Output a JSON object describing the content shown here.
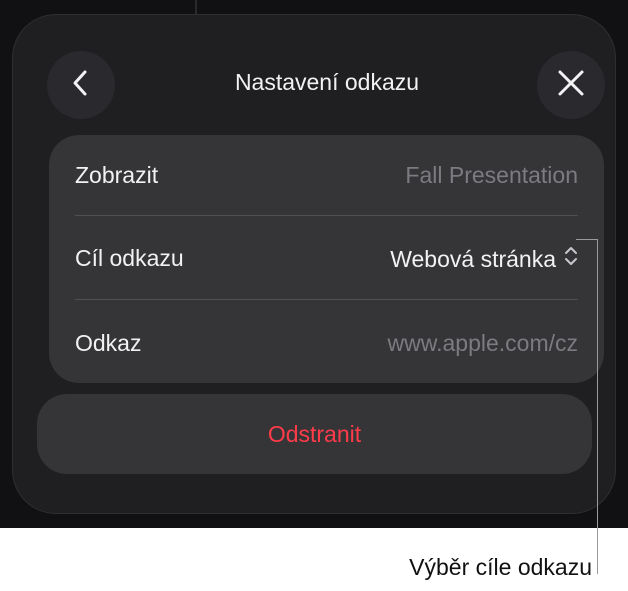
{
  "header": {
    "title": "Nastavení odkazu",
    "back_icon": "chevron-left-icon",
    "close_icon": "close-icon"
  },
  "settings": {
    "rows": [
      {
        "label": "Zobrazit",
        "value": "Fall Presentation"
      },
      {
        "label": "Cíl odkazu",
        "value": "Webová stránka",
        "icon": "chevron-up-down-icon"
      },
      {
        "label": "Odkaz",
        "value": "www.apple.com/cz"
      }
    ]
  },
  "actions": {
    "delete_label": "Odstranit"
  },
  "callout": {
    "text": "Výběr cíle odkazu"
  },
  "colors": {
    "background": "#111113",
    "sheet": "#1f1f22",
    "group": "#353538",
    "destructive": "#ff3b4a"
  }
}
